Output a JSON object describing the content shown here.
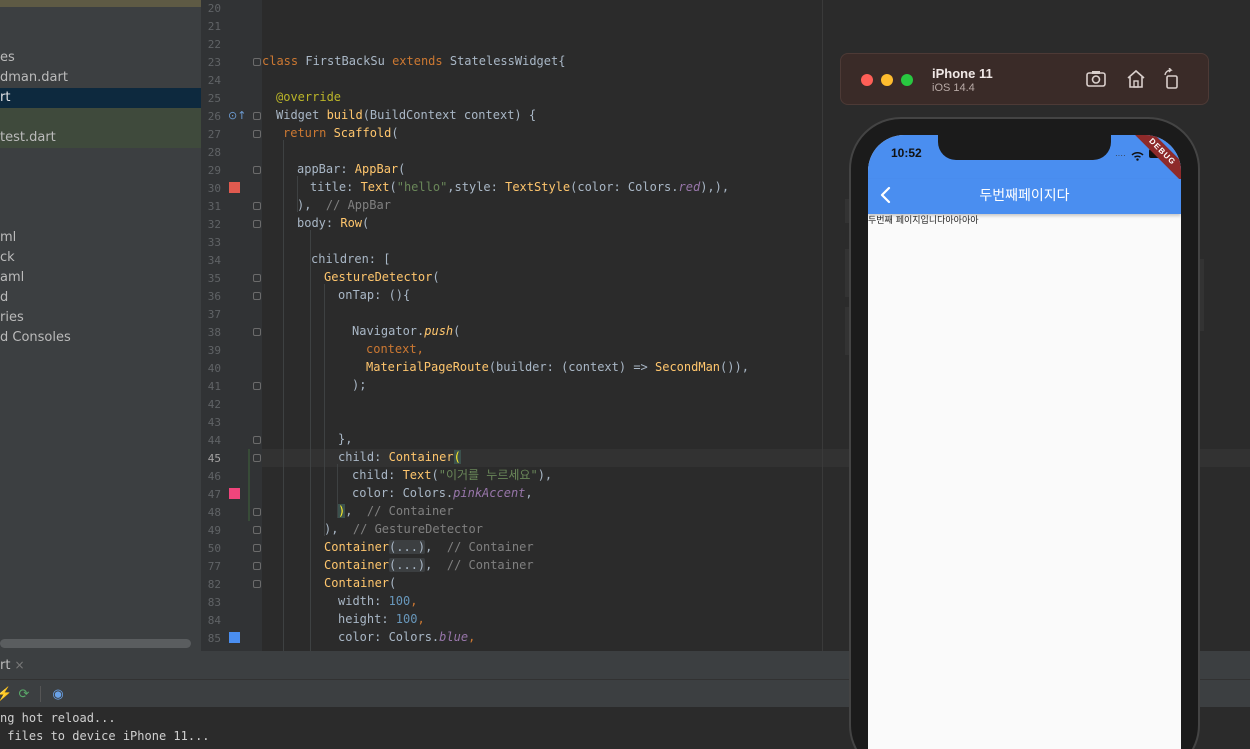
{
  "project_tree": {
    "items": [
      {
        "label": "es",
        "state": ""
      },
      {
        "label": "dman.dart",
        "state": ""
      },
      {
        "label": "rt",
        "state": "selected"
      },
      {
        "label": "",
        "state": "highlight"
      },
      {
        "label": "test.dart",
        "state": "highlight"
      },
      {
        "label": "",
        "state": ""
      },
      {
        "label": "",
        "state": ""
      },
      {
        "label": "",
        "state": ""
      },
      {
        "label": "",
        "state": ""
      },
      {
        "label": "ml",
        "state": ""
      },
      {
        "label": "ck",
        "state": ""
      },
      {
        "label": "aml",
        "state": ""
      },
      {
        "label": "d",
        "state": ""
      },
      {
        "label": "ries",
        "state": ""
      },
      {
        "label": "d Consoles",
        "state": ""
      }
    ]
  },
  "editor": {
    "line_numbers": [
      "20",
      "21",
      "22",
      "23",
      "24",
      "25",
      "26",
      "27",
      "28",
      "29",
      "30",
      "31",
      "32",
      "33",
      "34",
      "35",
      "36",
      "37",
      "38",
      "39",
      "40",
      "41",
      "42",
      "43",
      "44",
      "45",
      "46",
      "47",
      "48",
      "49",
      "50",
      "77",
      "82",
      "83",
      "84",
      "85"
    ],
    "current_line": "45",
    "gutter_colors": {
      "red": "#e05a4f",
      "pink_accent": "#f0457c",
      "blue": "#4a8ef0"
    },
    "code": {
      "l23_a": "class ",
      "l23_b": "FirstBackSu ",
      "l23_c": "extends ",
      "l23_d": "StatelessWidget{",
      "l25": "@override",
      "l26_a": "Widget ",
      "l26_b": "build",
      "l26_c": "(BuildContext context) {",
      "l27_a": "return ",
      "l27_b": "Scaffold",
      "l27_c": "(",
      "l29_a": "appBar: ",
      "l29_b": "AppBar",
      "l29_c": "(",
      "l30_a": "title: ",
      "l30_b": "Text",
      "l30_c": "(",
      "l30_d": "\"hello\"",
      "l30_e": ",style: ",
      "l30_f": "TextStyle",
      "l30_g": "(color: Colors.",
      "l30_h": "red",
      "l30_i": "),),",
      "l31_a": "),  ",
      "l31_b": "// AppBar",
      "l32_a": "body: ",
      "l32_b": "Row",
      "l32_c": "(",
      "l34": "children: [",
      "l35_a": "GestureDetector",
      "l35_b": "(",
      "l36": "onTap: (){",
      "l38_a": "Navigator.",
      "l38_b": "push",
      "l38_c": "(",
      "l39": "context,",
      "l40_a": "MaterialPageRoute",
      "l40_b": "(builder: (context) => ",
      "l40_c": "SecondMan",
      "l40_d": "()),",
      "l41": ");",
      "l44": "},",
      "l45_a": "child: ",
      "l45_b": "Container",
      "l45_c": "(",
      "l46_a": "child: ",
      "l46_b": "Text",
      "l46_c": "(",
      "l46_d": "\"이거를 누르세요\"",
      "l46_e": "),",
      "l47_a": "color: Colors.",
      "l47_b": "pinkAccent",
      "l47_c": ",",
      "l48_a": ")",
      "l48_b": ",  ",
      "l48_c": "// Container",
      "l49_a": "),  ",
      "l49_b": "// GestureDetector",
      "l50_a": "Container",
      "l50_b": "(...)",
      "l50_c": ",  ",
      "l50_d": "// Container",
      "l77_a": "Container",
      "l77_b": "(...)",
      "l77_c": ",  ",
      "l77_d": "// Container",
      "l82_a": "Container",
      "l82_b": "(",
      "l83_a": "width: ",
      "l83_b": "100",
      "l83_c": ",",
      "l84_a": "height: ",
      "l84_b": "100",
      "l84_c": ",",
      "l85_a": "color: Colors.",
      "l85_b": "blue",
      "l85_c": ","
    }
  },
  "run_panel": {
    "tab_label": "rt",
    "tab_close": "×",
    "output": [
      "ng hot reload...",
      " files to device iPhone 11..."
    ]
  },
  "simulator": {
    "device_name": "iPhone 11",
    "os_version": "iOS 14.4",
    "status_time": "10:52",
    "debug_banner": "DEBUG",
    "app_title": "두번째페이지다",
    "body_text": "두번째 페이지입니다아아아아",
    "appbar_color": "#4a8ef0"
  }
}
